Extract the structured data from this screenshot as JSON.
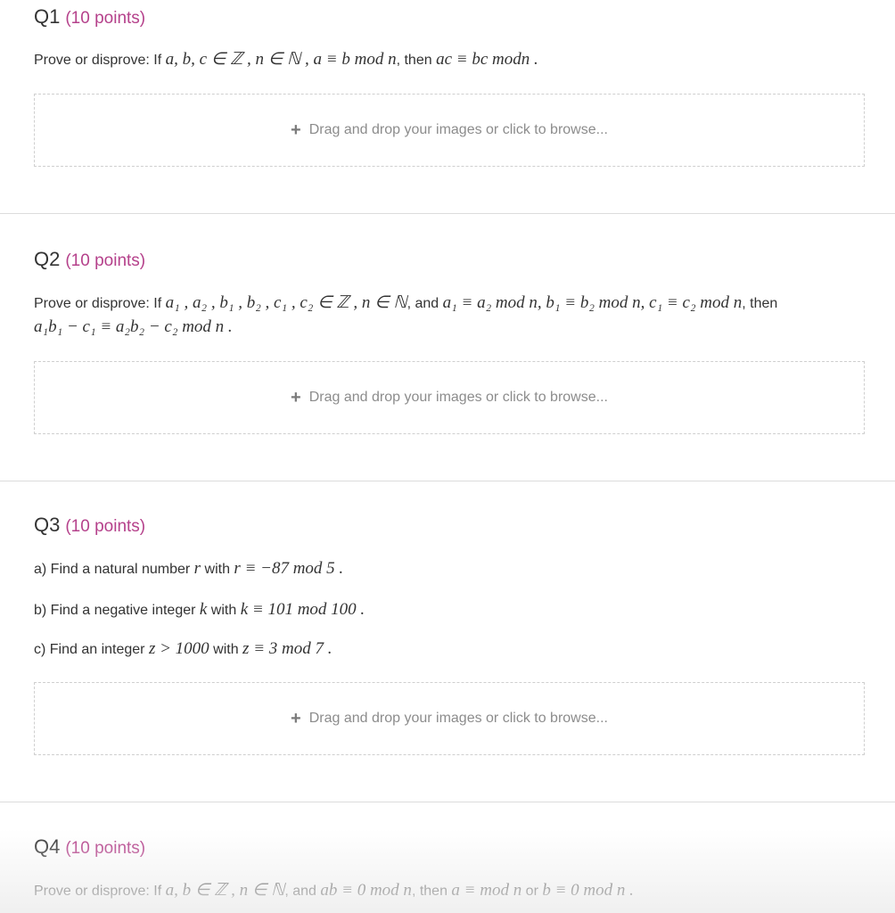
{
  "questions": [
    {
      "label": "Q1",
      "points": "(10 points)",
      "prompt_prefix": "Prove or disprove: If",
      "prompt_mid": ", then",
      "math_a": "a, b, c ∈ ℤ , n ∈ ℕ , a ≡ b mod n",
      "math_b": "ac ≡ bc modn ."
    },
    {
      "label": "Q2",
      "points": "(10 points)",
      "prompt_prefix": "Prove or disprove: If",
      "prompt_and": ", and",
      "prompt_then": ", then",
      "math_a": "a₁ , a₂ , b₁ , b₂ , c₁ , c₂ ∈ ℤ , n ∈ ℕ",
      "math_b": "a₁ ≡ a₂ mod n, b₁ ≡ b₂ mod n, c₁ ≡ c₂ mod n",
      "math_c": "a₁b₁ − c₁ ≡ a₂b₂ − c₂ mod n ."
    },
    {
      "label": "Q3",
      "points": "(10 points)",
      "part_a_text": "a) Find a natural number",
      "part_a_with": "with",
      "part_a_var": "r",
      "part_a_math": "r ≡ −87 mod 5 .",
      "part_b_text": "b) Find a negative integer",
      "part_b_with": "with",
      "part_b_var": "k",
      "part_b_math": "k ≡ 101 mod 100 .",
      "part_c_text": "c) Find an integer",
      "part_c_with": "with",
      "part_c_var": "z > 1000",
      "part_c_math": "z ≡ 3 mod 7 ."
    },
    {
      "label": "Q4",
      "points": "(10 points)",
      "prompt_prefix": "Prove or disprove: If",
      "prompt_and": ", and",
      "prompt_then": ", then",
      "prompt_or": "or",
      "math_a": "a, b ∈ ℤ , n ∈ ℕ",
      "math_b": "ab ≡ 0 mod n",
      "math_c": "a ≡  mod n",
      "math_d": "b ≡ 0 mod n ."
    }
  ],
  "upload": {
    "plus": "+",
    "text": "Drag and drop your images or click to browse..."
  }
}
